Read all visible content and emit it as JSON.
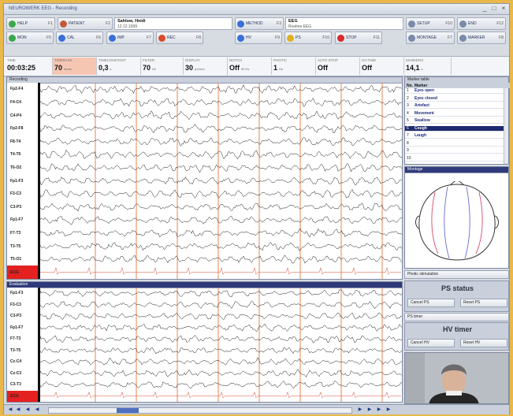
{
  "window": {
    "title": "NEUROWERK EEG - Recording",
    "controls": [
      "_",
      "□",
      "×"
    ]
  },
  "toolbar1": {
    "help": {
      "label": "HELP",
      "key": "F1"
    },
    "patient": {
      "label": "PATIENT",
      "key": "F2"
    },
    "patient_name": "Sahlow, Heidi",
    "patient_date": "12.12.1999",
    "method": {
      "label": "METHOD",
      "key": "F3"
    },
    "method_name": "EEG",
    "method_detail": "Routine EEG",
    "setup": {
      "label": "SETUP",
      "key": "F10"
    },
    "end": {
      "label": "END",
      "key": "F12"
    }
  },
  "toolbar2": {
    "items": [
      {
        "label": "MON",
        "key": "F5",
        "color": "#3aa84a"
      },
      {
        "label": "CAL",
        "key": "F6",
        "color": "#3a6fd8"
      },
      {
        "label": "IMP",
        "key": "F7",
        "color": "#3a6fd8"
      },
      {
        "label": "REC",
        "key": "F8",
        "color": "#d84a2a"
      },
      {
        "label": "HV",
        "key": "F9",
        "color": "#3a6fd8"
      },
      {
        "label": "PS",
        "key": "F10",
        "color": "#e0b020"
      },
      {
        "label": "STOP",
        "key": "F11",
        "color": "#d82a2a"
      },
      {
        "label": "MONTAGE",
        "key": "F7",
        "color": "#7a8aa8"
      },
      {
        "label": "MARKER",
        "key": "F8",
        "color": "#7a8aa8"
      }
    ]
  },
  "params": [
    {
      "label": "TIME",
      "value": "00:03:25",
      "unit": ""
    },
    {
      "label": "TIMEBASE",
      "value": "70",
      "unit": "mm/s"
    },
    {
      "label": "TIMECONSTANT",
      "value": "0,3",
      "unit": "s"
    },
    {
      "label": "FILTER",
      "value": "70",
      "unit": "Hz"
    },
    {
      "label": "DISPLAY",
      "value": "30",
      "unit": "µV/mm"
    },
    {
      "label": "NOTCH",
      "value": "Off",
      "unit": "50 Hz"
    },
    {
      "label": "PHOTIC",
      "value": "1",
      "unit": "Hz"
    },
    {
      "label": "AUTO STOP",
      "value": "Off",
      "unit": ""
    },
    {
      "label": "HV-TIME",
      "value": "Off",
      "unit": ""
    },
    {
      "label": "MARKERS",
      "value": "14,1",
      "unit": "s"
    }
  ],
  "recording_pane": {
    "title": "Recording",
    "channels": [
      "Fp2-F4",
      "F4-C4",
      "C4-P4",
      "Fp2-F8",
      "F8-T4",
      "T4-T6",
      "T6-O2",
      "Fp1-F3",
      "F3-C3",
      "C3-P3",
      "Fp1-F7",
      "F7-T3",
      "T3-T5",
      "T5-O1",
      "ECG"
    ]
  },
  "second_pane": {
    "title": "Evaluation",
    "channels": [
      "Fp1-F3",
      "F3-C3",
      "C3-P3",
      "Fp1-F7",
      "F7-T3",
      "T3-T5",
      "Cz-C4",
      "Cz-C3",
      "C3-T3",
      "ECG"
    ]
  },
  "marker_table": {
    "title": "Marker table",
    "col_no": "No.",
    "col_marker": "Marker",
    "rows": [
      {
        "n": "1",
        "e": "Eyes open"
      },
      {
        "n": "2",
        "e": "Eyes closed"
      },
      {
        "n": "3",
        "e": "Artefact"
      },
      {
        "n": "4",
        "e": "Movement"
      },
      {
        "n": "5",
        "e": "Swallow"
      },
      {
        "n": "6",
        "e": "Cough",
        "selected": true
      },
      {
        "n": "7",
        "e": "Laugh"
      },
      {
        "n": "8",
        "e": ""
      },
      {
        "n": "9",
        "e": ""
      },
      {
        "n": "10",
        "e": ""
      }
    ]
  },
  "montage_pane": {
    "title": "Montage"
  },
  "photic": {
    "label": "Photic stimulation"
  },
  "ps_status": {
    "title": "PS status",
    "cancel": "Cancel PS",
    "reset": "Reset PS",
    "ps_timer": "PS timer"
  },
  "hv_timer": {
    "title": "HV timer",
    "cancel": "Cancel HV",
    "reset": "Reset HV"
  },
  "colors": {
    "accent": "#1e2a6e",
    "ecg_red": "#e52020",
    "marker_line": "#e8793a",
    "background": "#e8b84a"
  }
}
